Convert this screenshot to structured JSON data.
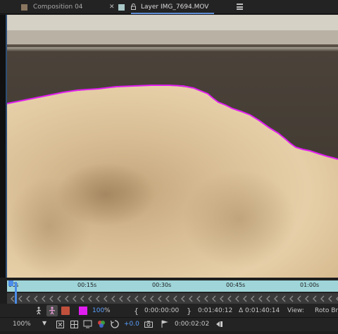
{
  "tabs": [
    {
      "label": "Composition 04",
      "color": "#8a7660"
    },
    {
      "label": "Layer IMG_7694.MOV",
      "color": "#a9c7c7"
    }
  ],
  "icons": {
    "close": "close-icon",
    "lock": "lock-icon",
    "menu": "panel-menu-icon"
  },
  "timeline": {
    "ticks": [
      "00s",
      "00:15s",
      "00:30s",
      "00:45s",
      "01:00s"
    ],
    "track_color": "#9fd5d9"
  },
  "controls": {
    "magnification_pct": "100",
    "pct_sign": "%",
    "in_time": "0:00:00:00",
    "out_time": "0:01:40:12",
    "duration": "Δ 0:01:40:14",
    "view_label": "View:",
    "view_value": "Roto Bru",
    "zoom": "100%",
    "exposure": "+0.0",
    "current_time": "0:00:02:02",
    "mask_color": "#e11ef0"
  }
}
